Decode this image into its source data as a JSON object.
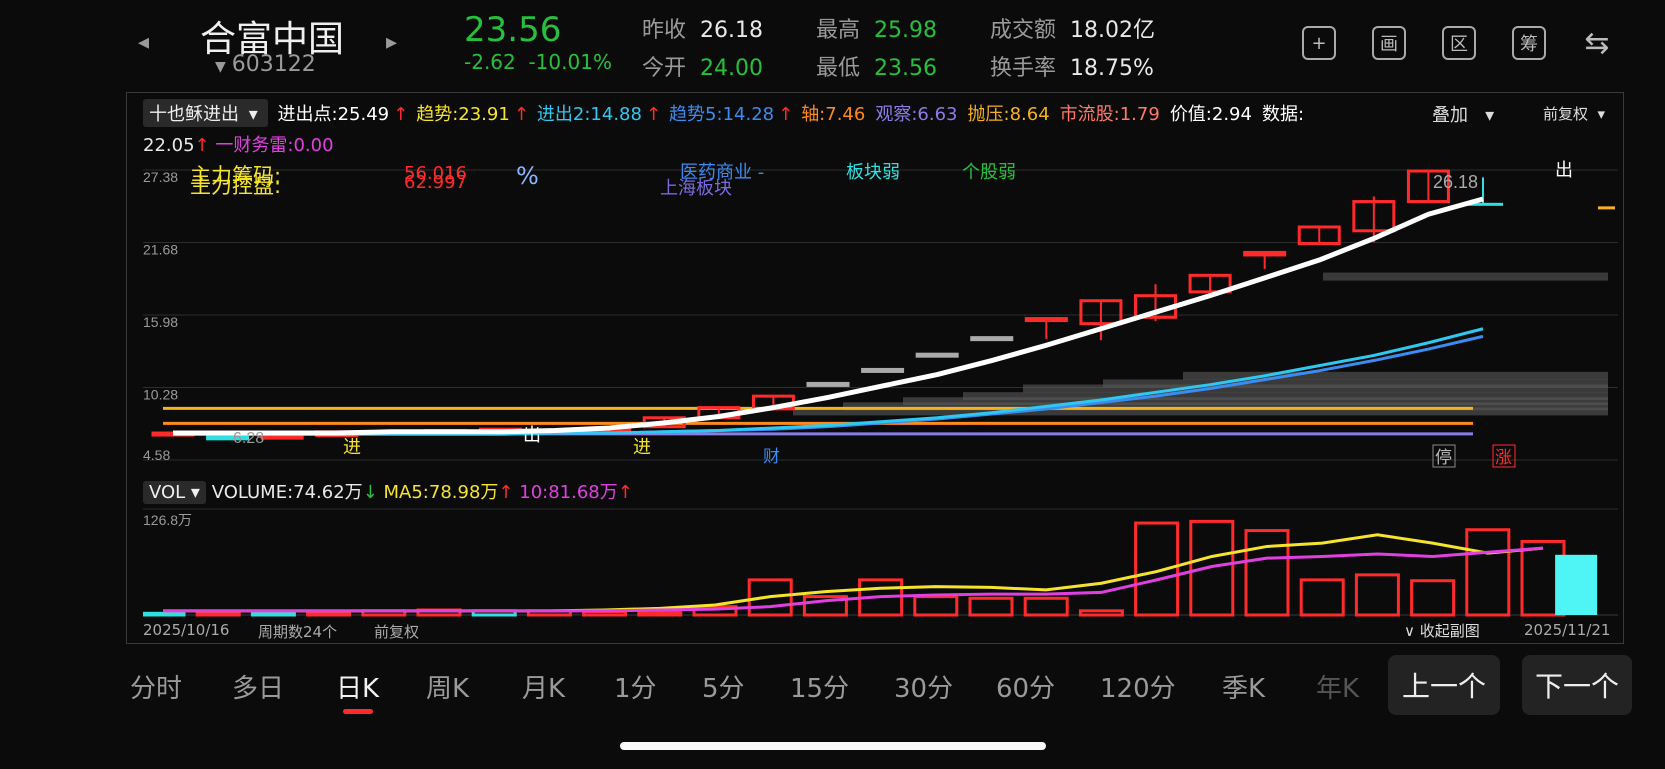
{
  "header": {
    "prev_arrow": "◂",
    "next_arrow": "▸",
    "name": "合富中国",
    "code": "603122",
    "code_caret": "▼",
    "price": "23.56",
    "change": "-2.62",
    "change_pct": "-10.01%",
    "stats": {
      "prev_close_label": "昨收",
      "prev_close": "26.18",
      "open_label": "今开",
      "open": "24.00",
      "high_label": "最高",
      "high": "25.98",
      "low_label": "最低",
      "low": "23.56",
      "amount_label": "成交额",
      "amount": "18.02亿",
      "turnover_label": "换手率",
      "turnover": "18.75%"
    },
    "icons": [
      {
        "name": "plus-square-icon",
        "glyph": "+"
      },
      {
        "name": "draw-icon",
        "glyph": "画"
      },
      {
        "name": "range-icon",
        "glyph": "区"
      },
      {
        "name": "chips-icon",
        "glyph": "筹"
      },
      {
        "name": "rotate-screen-icon",
        "glyph": "⇆"
      }
    ]
  },
  "indicator": {
    "selector": "十也稣进出",
    "line1": [
      {
        "label": "进出点:",
        "value": "25.49",
        "arrow": "↑",
        "color": "#ffffff"
      },
      {
        "label": "趋势:",
        "value": "23.91",
        "arrow": "↑",
        "color": "#f5e32c"
      },
      {
        "label": "进出2:",
        "value": "14.88",
        "arrow": "↑",
        "color": "#2ec8f0"
      },
      {
        "label": "趋势5:",
        "value": "14.28",
        "arrow": "↑",
        "color": "#3b8cf0"
      },
      {
        "label": "轴:",
        "value": "7.46",
        "arrow": "",
        "color": "#ff8a1c"
      },
      {
        "label": "观察:",
        "value": "6.63",
        "arrow": "",
        "color": "#8a7de8"
      },
      {
        "label": "抛压:",
        "value": "8.64",
        "arrow": "",
        "color": "#f5b21c"
      },
      {
        "label": "市流股:",
        "value": "1.79",
        "arrow": "",
        "color": "#ff7a6a"
      },
      {
        "label": "价值:",
        "value": "2.94",
        "arrow": "",
        "color": "#ffffff"
      },
      {
        "label": "数据:",
        "value": "",
        "arrow": "",
        "color": "#ffffff"
      }
    ],
    "line2_value": "22.05",
    "line2_arrow": "↑",
    "line2_label": "一财务雷:",
    "line2_num": "0.00",
    "overlay_label": "叠加",
    "adjust_label": "前复权"
  },
  "chart_data": {
    "type": "candlestick",
    "y_axis_labels": [
      "27.38",
      "21.68",
      "15.98",
      "10.28",
      "4.58"
    ],
    "ylim": [
      4.58,
      27.38
    ],
    "candles": [
      {
        "o": 6.6,
        "c": 6.7,
        "h": 6.8,
        "l": 6.5
      },
      {
        "o": 6.4,
        "c": 6.3,
        "h": 6.6,
        "l": 6.2
      },
      {
        "o": 6.3,
        "c": 6.5,
        "h": 6.6,
        "l": 6.2
      },
      {
        "o": 6.5,
        "c": 6.8,
        "h": 6.9,
        "l": 6.4
      },
      {
        "o": 6.8,
        "c": 6.8,
        "h": 6.9,
        "l": 6.7
      },
      {
        "o": 6.7,
        "c": 6.9,
        "h": 7.0,
        "l": 6.6
      },
      {
        "o": 6.9,
        "c": 7.0,
        "h": 7.1,
        "l": 6.8
      },
      {
        "o": 6.9,
        "c": 6.9,
        "h": 7.0,
        "l": 6.8
      },
      {
        "o": 6.9,
        "c": 7.1,
        "h": 7.2,
        "l": 6.8
      },
      {
        "o": 7.2,
        "c": 7.9,
        "h": 8.0,
        "l": 7.1
      },
      {
        "o": 7.9,
        "c": 8.7,
        "h": 8.8,
        "l": 7.8
      },
      {
        "o": 8.6,
        "c": 9.6,
        "h": 9.7,
        "l": 8.5
      },
      {
        "o": 10.6,
        "c": 10.6,
        "h": 10.6,
        "l": 10.6
      },
      {
        "o": 11.7,
        "c": 11.7,
        "h": 11.7,
        "l": 11.7
      },
      {
        "o": 12.9,
        "c": 12.9,
        "h": 12.9,
        "l": 12.9
      },
      {
        "o": 14.2,
        "c": 14.2,
        "h": 14.2,
        "l": 14.2
      },
      {
        "o": 15.7,
        "c": 15.7,
        "h": 15.7,
        "l": 14.1
      },
      {
        "o": 15.3,
        "c": 17.1,
        "h": 17.1,
        "l": 14.0
      },
      {
        "o": 15.8,
        "c": 17.5,
        "h": 18.4,
        "l": 15.5
      },
      {
        "o": 17.8,
        "c": 19.1,
        "h": 19.2,
        "l": 17.7
      },
      {
        "o": 20.7,
        "c": 20.9,
        "h": 21.0,
        "l": 19.6
      },
      {
        "o": 21.6,
        "c": 22.9,
        "h": 23.0,
        "l": 21.5
      },
      {
        "o": 22.6,
        "c": 24.9,
        "h": 25.3,
        "l": 21.7
      },
      {
        "o": 24.9,
        "c": 27.3,
        "h": 27.3,
        "l": 24.9
      },
      {
        "o": 24.8,
        "c": 24.6,
        "h": 26.8,
        "l": 24.6
      }
    ],
    "lines": {
      "white_ma": [
        6.7,
        6.7,
        6.7,
        6.7,
        6.8,
        6.8,
        6.8,
        6.9,
        7.1,
        7.5,
        8.0,
        8.7,
        9.5,
        10.4,
        11.3,
        12.4,
        13.6,
        14.9,
        16.2,
        17.5,
        18.9,
        20.3,
        22.0,
        23.9,
        25.1
      ],
      "cyan_ma": [
        6.6,
        6.6,
        6.6,
        6.6,
        6.6,
        6.6,
        6.6,
        6.7,
        6.7,
        6.8,
        6.9,
        7.1,
        7.3,
        7.6,
        7.9,
        8.3,
        8.8,
        9.3,
        9.9,
        10.5,
        11.2,
        12.0,
        12.8,
        13.8,
        14.9
      ],
      "blue_ma": [
        6.7,
        6.7,
        6.7,
        6.7,
        6.7,
        6.7,
        6.7,
        6.7,
        6.7,
        6.8,
        6.9,
        7.0,
        7.2,
        7.5,
        7.8,
        8.2,
        8.6,
        9.1,
        9.6,
        10.2,
        10.9,
        11.6,
        12.4,
        13.3,
        14.3
      ],
      "yellow_level": 8.64,
      "orange_level": 7.46,
      "purple_level": 6.63
    },
    "annotations": {
      "low_label": "6.28",
      "last_label": "26.18",
      "buy1": "进",
      "sell1": "出",
      "buy2": "进",
      "sell2": "出",
      "finance": "财",
      "stop": "停",
      "rise": "涨"
    },
    "overlay_texts": {
      "main_force_1": "主力筹码:",
      "main_force_2": "主力控盘:",
      "v1": "56.016",
      "v2": "62.997",
      "pct": "%",
      "sector1": "医药商业 -",
      "sector2": "上海板块",
      "sector_weak": "板块弱",
      "stock_weak": "个股弱"
    },
    "volume": {
      "ymax_label": "126.8万",
      "values": [
        2,
        2,
        2,
        3,
        5,
        6,
        5,
        5,
        4,
        3,
        10,
        42,
        22,
        42,
        22,
        20,
        20,
        5,
        110,
        112,
        101,
        42,
        48,
        41,
        102,
        88
      ],
      "ma5": [
        5,
        5,
        5,
        5,
        5,
        5,
        5,
        5,
        6,
        8,
        12,
        22,
        28,
        32,
        34,
        33,
        30,
        38,
        52,
        70,
        82,
        86,
        96,
        86,
        74,
        80
      ],
      "ma10": [
        5,
        5,
        5,
        5,
        5,
        5,
        5,
        5,
        5,
        6,
        7,
        10,
        17,
        22,
        24,
        25,
        25,
        27,
        42,
        58,
        68,
        70,
        73,
        70,
        75,
        80
      ],
      "last_cyan": 72
    }
  },
  "volume_bar": {
    "selector": "VOL",
    "volume_label": "VOLUME:",
    "volume": "74.62万",
    "volume_arrow": "↓",
    "ma5_label": "MA5:",
    "ma5": "78.98万",
    "ma5_arrow": "↑",
    "ma10_label": "10:",
    "ma10": "81.68万",
    "ma10_arrow": "↑"
  },
  "footer": {
    "start_date": "2025/10/16",
    "period_count": "周期数24个",
    "adjust": "前复权",
    "collapse": "收起副图",
    "end_date": "2025/11/21"
  },
  "tabs": [
    "分时",
    "多日",
    "日K",
    "周K",
    "月K",
    "1分",
    "5分",
    "15分",
    "30分",
    "60分",
    "120分",
    "季K",
    "年K"
  ],
  "active_tab": "日K",
  "nav": {
    "prev": "上一个",
    "next": "下一个"
  }
}
